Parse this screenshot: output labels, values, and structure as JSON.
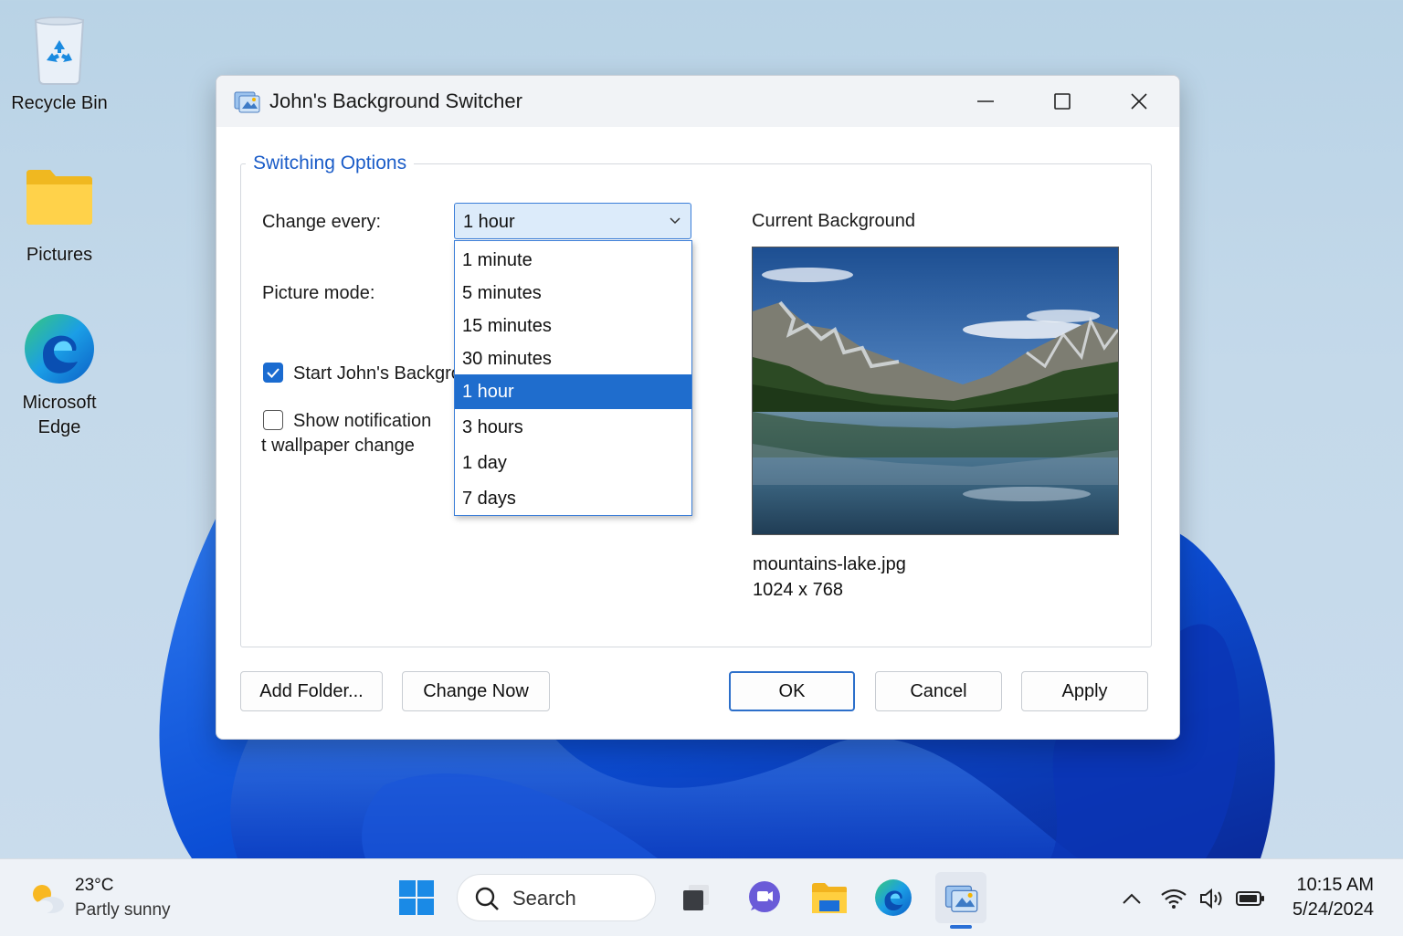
{
  "desktop": {
    "icons": [
      {
        "label": "Recycle Bin",
        "icon": "recycle-bin-icon"
      },
      {
        "label": "Pictures",
        "icon": "folder-icon"
      },
      {
        "label": "Microsoft\nEdge",
        "icon": "edge-icon"
      }
    ]
  },
  "dialog": {
    "title": "John's Background Switcher",
    "group_label": "Switching Options",
    "change_every_label": "Change every:",
    "picture_mode_label": "Picture mode:",
    "interval": {
      "selected": "1 hour",
      "options": [
        "1 minute",
        "5 minutes",
        "15 minutes",
        "30 minutes",
        "1 hour",
        "3 hours",
        "1 day",
        "7 days"
      ]
    },
    "start_checkbox": {
      "label": "Start John's Backgro",
      "checked": true
    },
    "notify_checkbox": {
      "label_line1": "Show notification",
      "label_line2": "t wallpaper change",
      "checked": false
    },
    "preview": {
      "title": "Current Background",
      "file_name": "mountains-lake.jpg",
      "dimensions": "1024 x 768"
    },
    "buttons": {
      "add_folder": "Add Folder...",
      "change_now": "Change Now",
      "ok": "OK",
      "cancel": "Cancel",
      "apply": "Apply"
    }
  },
  "taskbar": {
    "weather": {
      "temp": "23°C",
      "desc": "Partly sunny"
    },
    "search_placeholder": "Search",
    "apps": [
      "start-icon",
      "task-view-icon",
      "chat-icon",
      "file-explorer-icon",
      "edge-icon",
      "background-switcher-icon"
    ],
    "clock": {
      "time": "10:15 AM",
      "date": "5/24/2024"
    }
  },
  "colors": {
    "accent": "#1f6dcd",
    "legend": "#1a5cc8"
  }
}
